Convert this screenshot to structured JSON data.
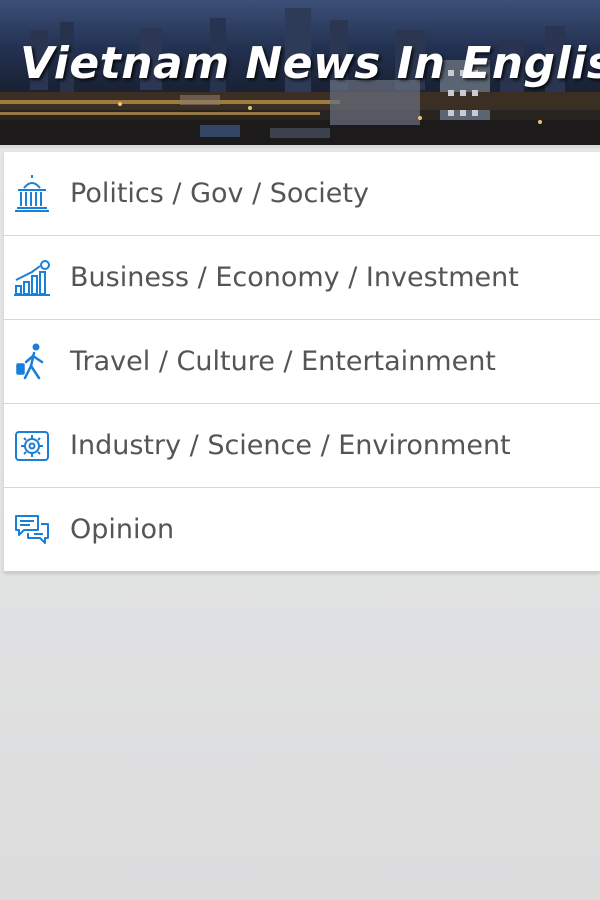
{
  "header": {
    "title": "Vietnam News In English"
  },
  "menu": {
    "items": [
      {
        "label": "Politics / Gov / Society",
        "icon": "government-building-icon"
      },
      {
        "label": "Business / Economy / Investment",
        "icon": "business-chart-icon"
      },
      {
        "label": "Travel / Culture / Entertainment",
        "icon": "traveler-icon"
      },
      {
        "label": "Industry / Science / Environment",
        "icon": "industry-gear-icon"
      },
      {
        "label": "Opinion",
        "icon": "speech-bubbles-icon"
      }
    ]
  },
  "colors": {
    "icon": "#1a7fd8",
    "label": "#555555",
    "background": "#e4e5e6"
  }
}
